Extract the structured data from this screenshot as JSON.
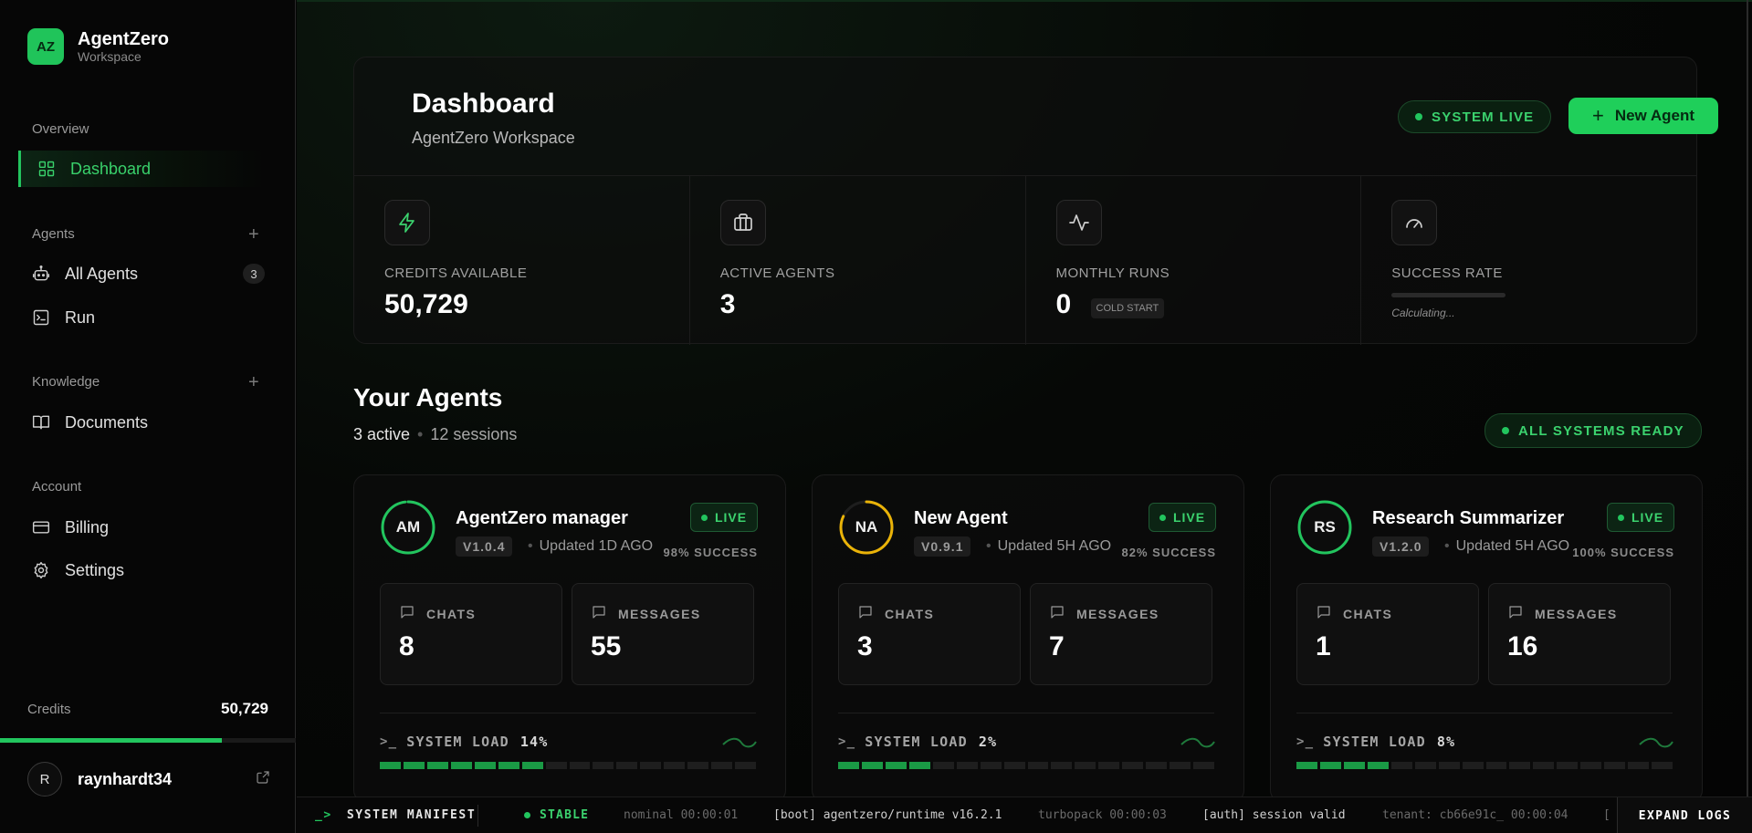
{
  "brand": {
    "logo": "AZ",
    "title": "AgentZero",
    "subtitle": "Workspace"
  },
  "sidebar": {
    "sections": [
      {
        "label": "Overview"
      },
      {
        "label": "Agents",
        "add": "+"
      },
      {
        "label": "Knowledge",
        "add": "+"
      },
      {
        "label": "Account"
      }
    ],
    "items": {
      "dashboard": {
        "label": "Dashboard",
        "icon": "grid-icon",
        "active": true
      },
      "all_agents": {
        "label": "All Agents",
        "icon": "robot-icon",
        "count": "3"
      },
      "run": {
        "label": "Run",
        "icon": "terminal-icon"
      },
      "documents": {
        "label": "Documents",
        "icon": "book-icon"
      },
      "billing": {
        "label": "Billing",
        "icon": "credit-card-icon"
      },
      "settings": {
        "label": "Settings",
        "icon": "gear-icon"
      }
    },
    "credits": {
      "label": "Credits",
      "value": "50,729",
      "fill_fraction": 0.75
    },
    "user": {
      "initial": "R",
      "name": "raynhardt34"
    }
  },
  "header": {
    "title": "Dashboard",
    "subtitle": "AgentZero Workspace",
    "status": "SYSTEM LIVE",
    "new_agent_label": "New Agent"
  },
  "stats": {
    "credits": {
      "label": "CREDITS AVAILABLE",
      "value": "50,729",
      "icon": "bolt-icon"
    },
    "active": {
      "label": "ACTIVE AGENTS",
      "value": "3",
      "icon": "briefcase-icon"
    },
    "runs": {
      "label": "MONTHLY RUNS",
      "value": "0",
      "tag": "COLD START",
      "icon": "activity-icon"
    },
    "success": {
      "label": "SUCCESS RATE",
      "status": "Calculating...",
      "icon": "gauge-icon"
    }
  },
  "agents_section": {
    "title": "Your Agents",
    "active": "3 active",
    "sessions": "12 sessions",
    "status": "ALL SYSTEMS READY"
  },
  "agents": [
    {
      "initials": "AM",
      "name": "AgentZero manager",
      "version": "V1.0.4",
      "updated": "Updated 1D AGO",
      "live": "LIVE",
      "success": "98% SUCCESS",
      "success_fraction": 0.98,
      "ring_color": "#22c55e",
      "chats_label": "CHATS",
      "chats": "8",
      "messages_label": "MESSAGES",
      "messages": "55",
      "load_label": "SYSTEM LOAD",
      "load": "14%",
      "segments_on": 7
    },
    {
      "initials": "NA",
      "name": "New Agent",
      "version": "V0.9.1",
      "updated": "Updated 5H AGO",
      "live": "LIVE",
      "success": "82% SUCCESS",
      "success_fraction": 0.82,
      "ring_color": "#eab308",
      "chats_label": "CHATS",
      "chats": "3",
      "messages_label": "MESSAGES",
      "messages": "7",
      "load_label": "SYSTEM LOAD",
      "load": "2%",
      "segments_on": 4
    },
    {
      "initials": "RS",
      "name": "Research Summarizer",
      "version": "V1.2.0",
      "updated": "Updated 5H AGO",
      "live": "LIVE",
      "success": "100% SUCCESS",
      "success_fraction": 1.0,
      "ring_color": "#22c55e",
      "chats_label": "CHATS",
      "chats": "1",
      "messages_label": "MESSAGES",
      "messages": "16",
      "load_label": "SYSTEM LOAD",
      "load": "8%",
      "segments_on": 4
    }
  ],
  "footer": {
    "manifest": "SYSTEM MANIFEST",
    "prompt": "_>",
    "stable": "STABLE",
    "logs": [
      {
        "text": "nominal 00:00:01",
        "tone": "dim"
      },
      {
        "text": "[boot] agentzero/runtime v16.2.1",
        "tone": "bright"
      },
      {
        "text": "turbopack 00:00:03",
        "tone": "dim"
      },
      {
        "text": "[auth] session valid",
        "tone": "bright"
      },
      {
        "text": "tenant: cb66e91c_ 00:00:04",
        "tone": "dim"
      },
      {
        "text": "[",
        "tone": "dim"
      }
    ],
    "expand": "EXPAND LOGS"
  }
}
